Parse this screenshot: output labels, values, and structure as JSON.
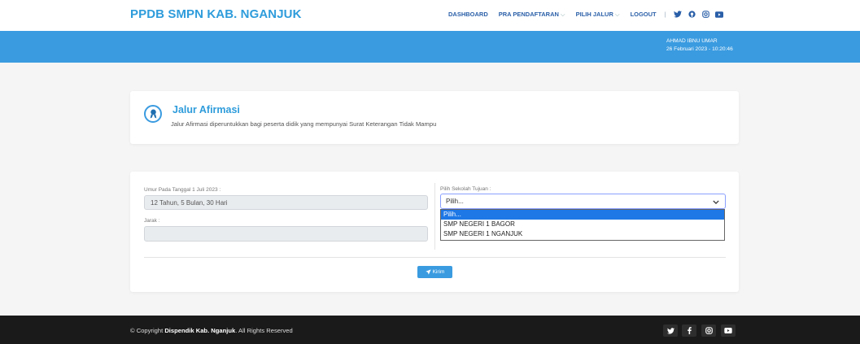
{
  "brand": "PPDB SMPN KAB. NGANJUK",
  "nav": {
    "dashboard": "DASHBOARD",
    "pra_pendaftaran": "PRA PENDAFTARAN",
    "pilih_jalur": "PILIH JALUR",
    "logout": "LOGOUT",
    "separator": "|",
    "chevron": "⌵",
    "social_icons": [
      "twitter-icon",
      "github-icon",
      "instagram-icon",
      "youtube-icon"
    ]
  },
  "user": {
    "name": "AHMAD IBNU UMAR",
    "datetime": "26 Februari 2023 - 10:20:46"
  },
  "header_card": {
    "icon": "award-icon",
    "title": "Jalur Afirmasi",
    "description": "Jalur Afirmasi diperuntukkan bagi peserta didik yang mempunyai Surat Keterangan Tidak Mampu"
  },
  "form": {
    "umur_label": "Umur Pada Tanggal 1 Juli 2023 :",
    "umur_value": "12 Tahun, 5 Bulan, 30 Hari",
    "jarak_label": "Jarak :",
    "jarak_value": "",
    "sekolah_label": "Pilih Sekolah Tujuan :",
    "sekolah_selected": "Pilih...",
    "sekolah_options": [
      "Pilih...",
      "SMP NEGERI 1 BAGOR",
      "SMP NEGERI 1 NGANJUK"
    ],
    "submit_label": "Kirim",
    "submit_icon": "send-icon"
  },
  "footer": {
    "copyright_prefix": "© Copyright ",
    "copyright_owner": "Dispendik Kab. Nganjuk",
    "copyright_suffix": ". All Rights Reserved",
    "social_icons": [
      "twitter-icon",
      "facebook-icon",
      "instagram-icon",
      "youtube-icon"
    ]
  },
  "colors": {
    "accent": "#3a9be0",
    "nav_text": "#2a5fa8",
    "selected_option": "#1e78e6",
    "footer_bg": "#1a1a1a"
  }
}
